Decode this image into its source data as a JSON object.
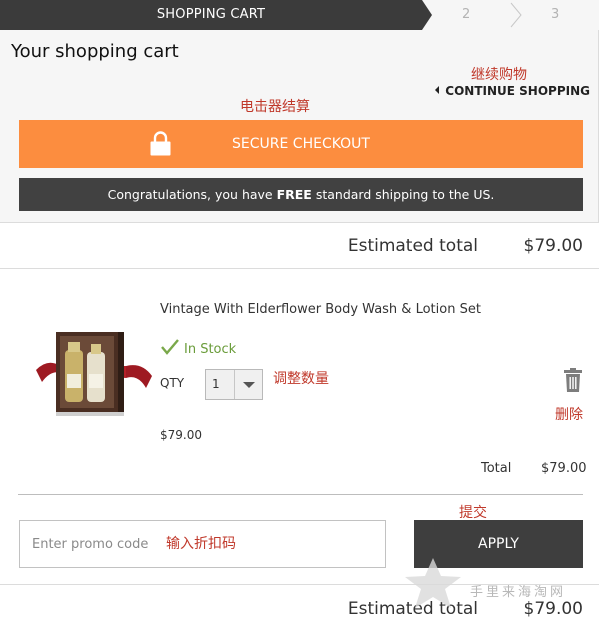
{
  "steps": [
    {
      "label": "SHOPPING CART"
    },
    {
      "label": "2"
    },
    {
      "label": "3"
    }
  ],
  "page_title": "Your shopping cart",
  "continue_shopping": "CONTINUE SHOPPING",
  "checkout_button": "SECURE CHECKOUT",
  "shipping_banner": {
    "before": "Congratulations, you have ",
    "bold": "FREE",
    "after": " standard shipping to the US."
  },
  "estimated_total": {
    "label": "Estimated total",
    "value": "$79.00"
  },
  "item": {
    "name": "Vintage With Elderflower Body Wash & Lotion Set",
    "stock": "In Stock",
    "qty_label": "QTY",
    "qty_value": "1",
    "price": "$79.00",
    "total_label": "Total",
    "total_value": "$79.00"
  },
  "promo": {
    "placeholder": "Enter promo code",
    "apply_label": "APPLY"
  },
  "annotations": {
    "continue_shopping": "继续购物",
    "checkout": "电击器结算",
    "qty": "调整数量",
    "delete": "删除",
    "submit": "提交",
    "promo": "输入折扣码"
  },
  "watermark": "手里来海淘网",
  "colors": {
    "checkout_orange": "#fc8d3f",
    "dark_bar": "#3b3b3b",
    "banner_dark": "#414141",
    "apply_dark": "#3e3e3e",
    "in_stock_green": "#6a9c3a",
    "annotation_red": "#c0392b"
  },
  "icons": [
    "lock-icon",
    "check-icon",
    "chevron-down-icon",
    "trash-icon",
    "chevron-left-icon",
    "star-watermark-icon"
  ]
}
